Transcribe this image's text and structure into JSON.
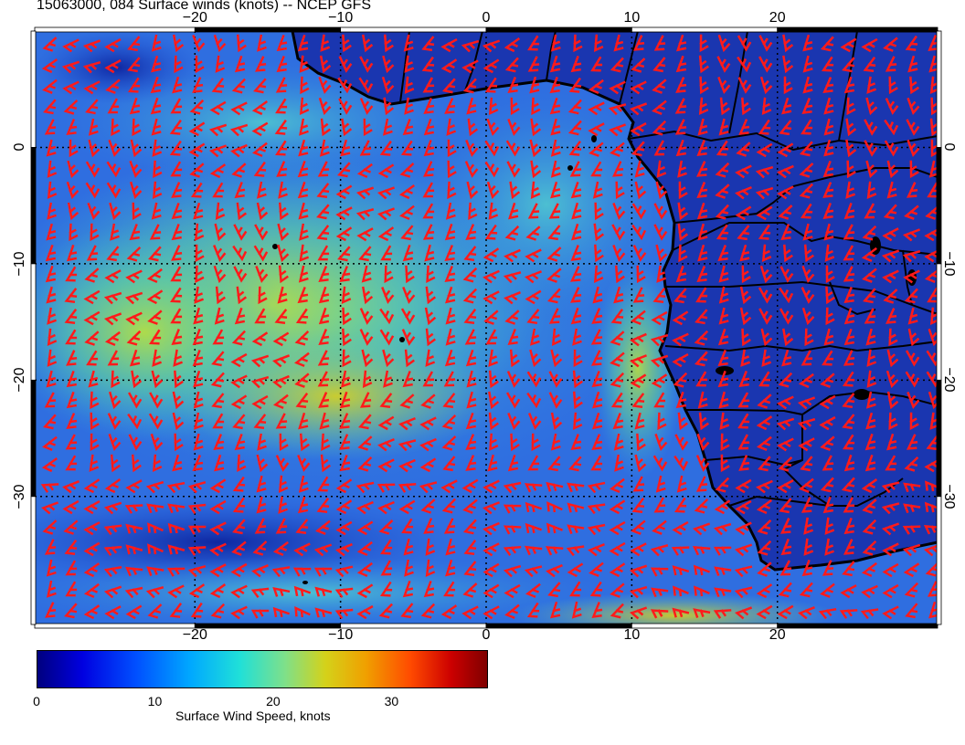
{
  "title": "15063000, 084 Surface winds (knots) -- NCEP GFS",
  "map": {
    "lon_range": [
      -31,
      31
    ],
    "lat_range": [
      -41,
      10
    ],
    "lon_grid": [
      -20,
      -10,
      0,
      10,
      20
    ],
    "lat_grid": [
      0,
      -10,
      -20,
      -30
    ],
    "lon_tick_labels": [
      "−20",
      "−10",
      "0",
      "10",
      "20"
    ],
    "lat_tick_labels": [
      "0",
      "−10",
      "−20",
      "−30"
    ],
    "ocean_color": "#2f6ee0",
    "land_color": "#1832a8",
    "barb_color": "#ff1a1a"
  },
  "colorbar": {
    "label": "Surface Wind Speed, knots",
    "range": [
      0,
      38
    ],
    "ticks": [
      "0",
      "10",
      "20",
      "30"
    ],
    "tick_values": [
      0,
      10,
      20,
      30
    ]
  }
}
